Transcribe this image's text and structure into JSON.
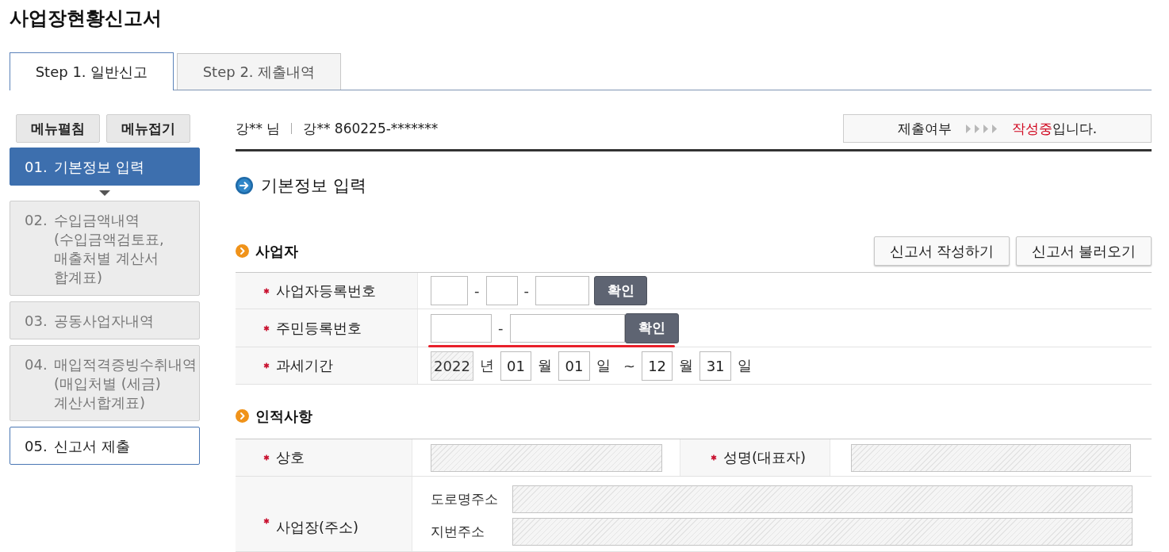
{
  "page": {
    "title": "사업장현황신고서"
  },
  "tabs": [
    {
      "label": "Step 1. 일반신고",
      "selected": true
    },
    {
      "label": "Step 2. 제출내역",
      "selected": false
    }
  ],
  "sidebar": {
    "buttons": [
      "메뉴펼침",
      "메뉴접기"
    ],
    "items": [
      {
        "number": "01.",
        "label": "기본정보 입력",
        "selected": true,
        "disabled": false
      },
      {
        "number": "02.",
        "label": "수입금액내역 (수입금액검토표, 매출처별 계산서 합계표)",
        "selected": false,
        "disabled": true
      },
      {
        "number": "03.",
        "label": "공동사업자내역",
        "selected": false,
        "disabled": true
      },
      {
        "number": "04.",
        "label": "매입적격증빙수취내역 (매입처별 (세금) 계산서합계표)",
        "selected": false,
        "disabled": true
      },
      {
        "number": "05.",
        "label": "신고서 제출",
        "selected": false,
        "disabled": false
      }
    ]
  },
  "user": {
    "name": "강** 님",
    "id": "강** 860225-*******"
  },
  "submission_status": {
    "label": "제출여부",
    "status": "작성중",
    "suffix": "입니다."
  },
  "section_title": "기본정보 입력",
  "groups": [
    {
      "title": "사업자",
      "buttons": [
        "신고서 작성하기",
        "신고서 불러오기"
      ],
      "rows": [
        {
          "highlighted": false,
          "cells": [
            {
              "label": "사업자등록번호",
              "required": true,
              "parts": [
                {
                  "kind": "input",
                  "disabled": false
                },
                {
                  "kind": "text",
                  "text": "-"
                },
                {
                  "kind": "input",
                  "disabled": false
                },
                {
                  "kind": "text",
                  "text": "-"
                },
                {
                  "kind": "input",
                  "disabled": false
                },
                {
                  "kind": "button",
                  "text": "확인"
                }
              ]
            }
          ]
        },
        {
          "highlighted": true,
          "cells": [
            {
              "label": "주민등록번호",
              "required": true,
              "parts": [
                {
                  "kind": "input",
                  "disabled": false
                },
                {
                  "kind": "text",
                  "text": "-"
                },
                {
                  "kind": "input",
                  "disabled": false
                },
                {
                  "kind": "button",
                  "text": "확인"
                }
              ]
            }
          ]
        },
        {
          "highlighted": false,
          "cells": [
            {
              "label": "과세기간",
              "required": true,
              "parts": [
                {
                  "kind": "input",
                  "value": "2022",
                  "disabled": true
                },
                {
                  "kind": "text",
                  "text": "년"
                },
                {
                  "kind": "input",
                  "value": "01",
                  "disabled": false
                },
                {
                  "kind": "text",
                  "text": "월"
                },
                {
                  "kind": "input",
                  "value": "01",
                  "disabled": false
                },
                {
                  "kind": "text",
                  "text": "일"
                },
                {
                  "kind": "text",
                  "text": "~"
                },
                {
                  "kind": "input",
                  "value": "12",
                  "disabled": false
                },
                {
                  "kind": "text",
                  "text": "월"
                },
                {
                  "kind": "input",
                  "value": "31",
                  "disabled": false
                },
                {
                  "kind": "text",
                  "text": "일"
                }
              ]
            }
          ]
        }
      ]
    },
    {
      "title": "인적사항",
      "rows": [
        {
          "highlighted": false,
          "cells": [
            {
              "label": "상호",
              "required": true,
              "parts": [
                {
                  "kind": "input",
                  "disabled": true
                }
              ]
            },
            {
              "label": "성명(대표자)",
              "required": true,
              "parts": [
                {
                  "kind": "input",
                  "disabled": true
                }
              ]
            }
          ]
        },
        {
          "highlighted": false,
          "cells": [
            {
              "label": "사업장(주소)",
              "required": true,
              "lines": [
                {
                  "label": "도로명주소",
                  "parts": [
                    {
                      "kind": "input",
                      "disabled": true
                    }
                  ]
                },
                {
                  "label": "지번주소",
                  "parts": [
                    {
                      "kind": "input",
                      "disabled": true
                    }
                  ]
                }
              ]
            }
          ]
        }
      ]
    }
  ]
}
